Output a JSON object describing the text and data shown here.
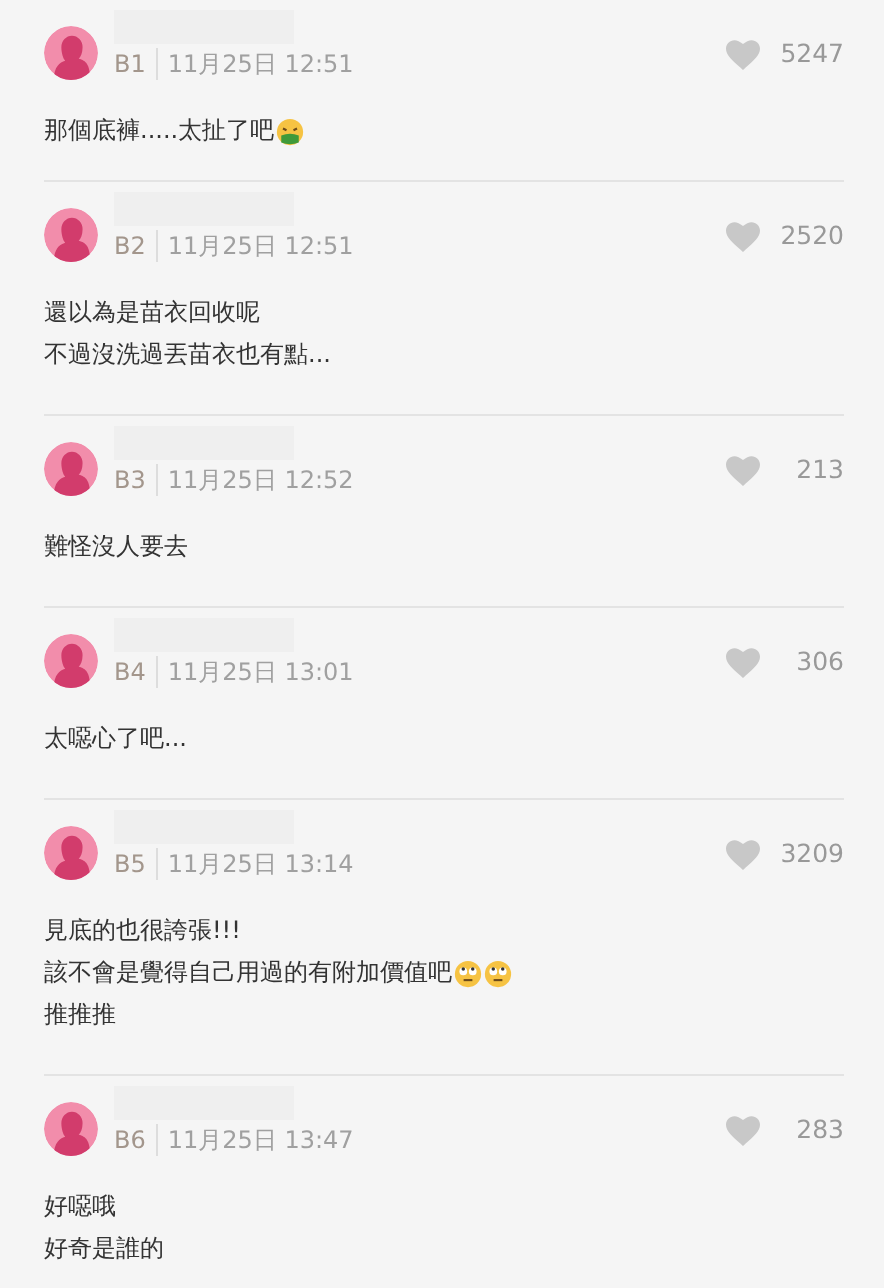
{
  "comments": [
    {
      "floor": "B1",
      "time": "11月25日 12:51",
      "liked": false,
      "likes": "5247",
      "lines": [
        {
          "text": "那個底褲.....太扯了吧",
          "icons": [
            {
              "kind": "vomiting-face"
            }
          ]
        }
      ]
    },
    {
      "floor": "B2",
      "time": "11月25日 12:51",
      "liked": false,
      "likes": "2520",
      "lines": [
        {
          "text": "還以為是苗衣回收呢"
        },
        {
          "text": "不過沒洗過丟苗衣也有點..."
        }
      ]
    },
    {
      "floor": "B3",
      "time": "11月25日 12:52",
      "liked": false,
      "likes": "213",
      "lines": [
        {
          "text": "難怪沒人要去"
        }
      ]
    },
    {
      "floor": "B4",
      "time": "11月25日 13:01",
      "liked": false,
      "likes": "306",
      "lines": [
        {
          "text": "太噁心了吧..."
        }
      ]
    },
    {
      "floor": "B5",
      "time": "11月25日 13:14",
      "liked": false,
      "likes": "3209",
      "lines": [
        {
          "text": "見底的也很誇張!!!"
        },
        {
          "text": "該不會是覺得自己用過的有附加價值吧",
          "icons": [
            {
              "kind": "eye-roll-face"
            },
            {
              "kind": "eye-roll-face"
            }
          ]
        },
        {
          "text": "推推推"
        }
      ]
    },
    {
      "floor": "B6",
      "time": "11月25日 13:47",
      "liked": false,
      "likes": "283",
      "lines": [
        {
          "text": "好噁哦"
        },
        {
          "text": "好奇是誰的"
        }
      ]
    }
  ]
}
